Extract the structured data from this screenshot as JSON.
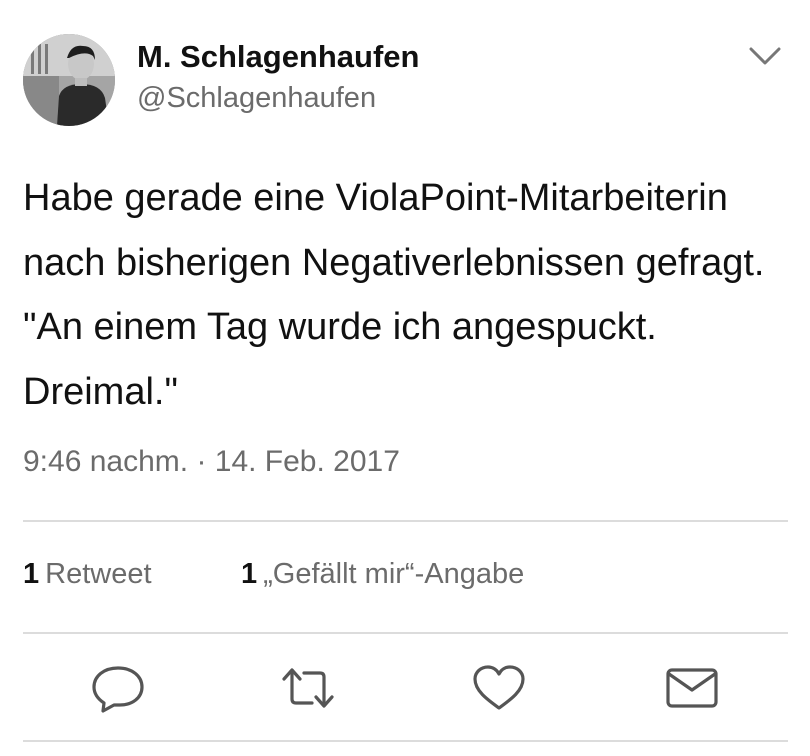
{
  "tweet": {
    "author_name": "M. Schlagenhaufen",
    "author_handle": "@Schlagenhaufen",
    "text": "Habe gerade eine ViolaPoint-Mitarbeiterin nach bisherigen Negativerlebnissen gefragt. \"An einem Tag wurde ich angespuckt. Dreimal.\"",
    "timestamp": "9:46 nachm. · 14. Feb. 2017",
    "retweet_count": "1",
    "retweet_label": "Retweet",
    "like_count": "1",
    "like_label": "„Gefällt mir“-Angabe"
  },
  "icons": {
    "menu": "chevron-down-icon",
    "reply": "reply-icon",
    "retweet": "retweet-icon",
    "like": "heart-icon",
    "dm": "envelope-icon"
  },
  "colors": {
    "text": "#111111",
    "secondary": "#6b6b6b",
    "divider": "#dcdcdc",
    "icon": "#555555"
  }
}
